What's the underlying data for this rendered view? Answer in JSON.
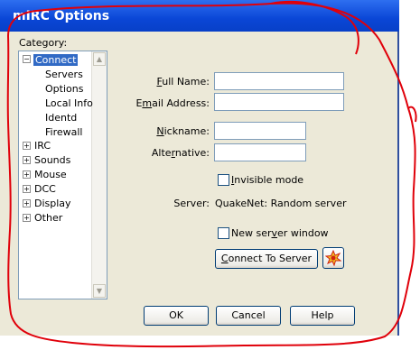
{
  "window": {
    "title": "mIRC Options"
  },
  "category_label": "Category:",
  "tree": {
    "connect": {
      "label": "Connect",
      "expander": "−",
      "children": [
        "Servers",
        "Options",
        "Local Info",
        "Identd",
        "Firewall"
      ]
    },
    "others": [
      {
        "label": "IRC",
        "expander": "+"
      },
      {
        "label": "Sounds",
        "expander": "+"
      },
      {
        "label": "Mouse",
        "expander": "+"
      },
      {
        "label": "DCC",
        "expander": "+"
      },
      {
        "label": "Display",
        "expander": "+"
      },
      {
        "label": "Other",
        "expander": "+"
      }
    ]
  },
  "form": {
    "full_name": {
      "label_key": "F",
      "label_rest": "ull Name:",
      "value": ""
    },
    "email": {
      "label_pre": "E",
      "label_key": "m",
      "label_rest": "ail Address:",
      "value": ""
    },
    "nickname": {
      "label_key": "N",
      "label_rest": "ickname:",
      "value": ""
    },
    "alternative": {
      "label_pre": "Alte",
      "label_key": "r",
      "label_rest": "native:",
      "value": ""
    },
    "invisible_mode": {
      "label_key": "I",
      "label_rest": "nvisible mode",
      "checked": false
    },
    "server_label": "Server:",
    "server_value": "QuakeNet: Random server",
    "new_server_window": {
      "label_pre": "New ser",
      "label_key": "v",
      "label_rest": "er window",
      "checked": false
    },
    "connect_button": {
      "label_key": "C",
      "label_rest": "onnect To Server"
    }
  },
  "buttons": {
    "ok": "OK",
    "cancel": "Cancel",
    "help": "Help"
  },
  "colors": {
    "annotation": "#e0000a",
    "title_bar": "#0a46d6",
    "selection": "#316ac5"
  }
}
